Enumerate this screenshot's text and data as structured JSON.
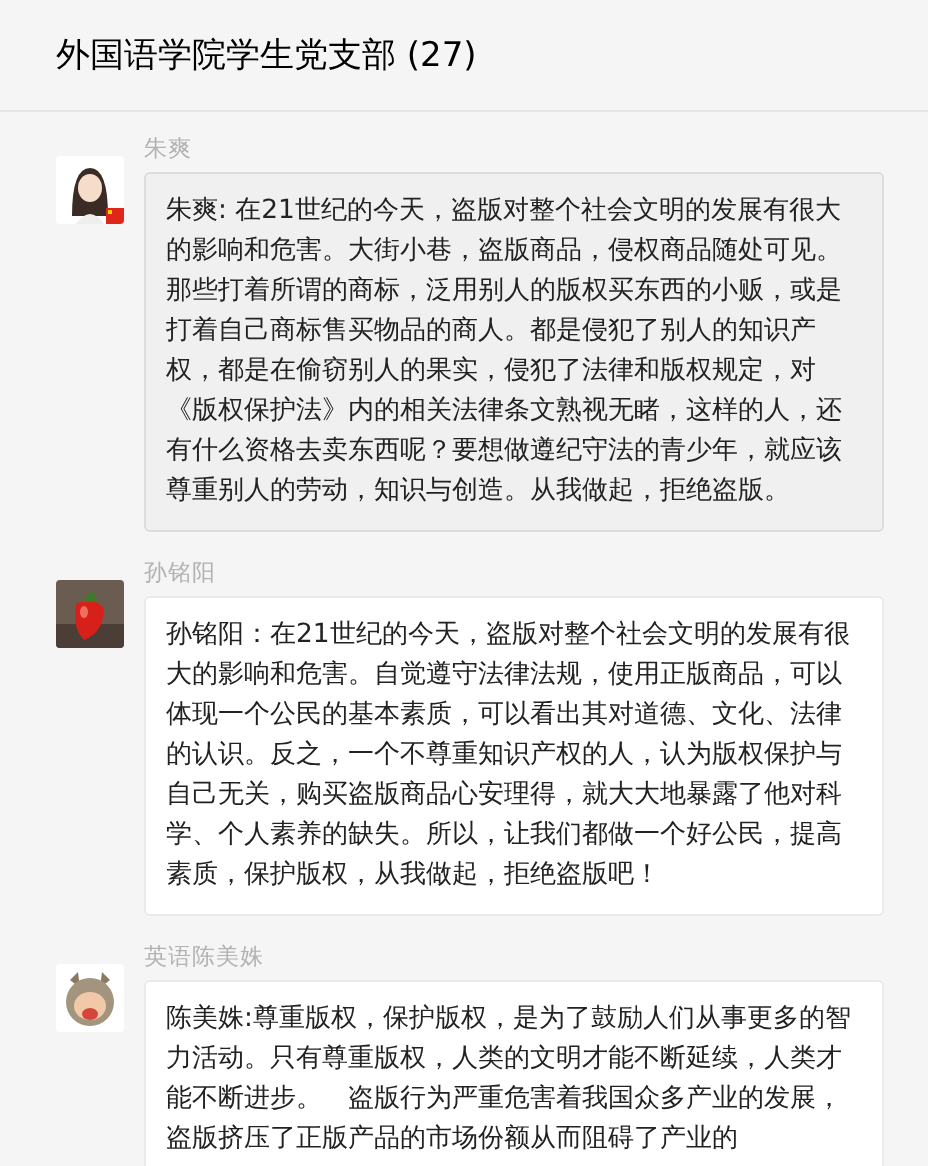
{
  "header": {
    "title": "外国语学院学生党支部 (27)"
  },
  "messages": [
    {
      "sender": "朱爽",
      "highlighted": true,
      "text": "朱爽: 在21世纪的今天，盗版对整个社会文明的发展有很大的影响和危害。大街小巷，盗版商品，侵权商品随处可见。那些打着所谓的商标，泛用别人的版权买东西的小贩，或是打着自己商标售买物品的商人。都是侵犯了别人的知识产权，都是在偷窃别人的果实，侵犯了法律和版权规定，对《版权保护法》内的相关法律条文熟视无睹，这样的人，还有什么资格去卖东西呢？要想做遵纪守法的青少年，就应该尊重别人的劳动，知识与创造。从我做起，拒绝盗版。"
    },
    {
      "sender": "孙铭阳",
      "highlighted": false,
      "text": "孙铭阳：在21世纪的今天，盗版对整个社会文明的发展有很大的影响和危害。自觉遵守法律法规，使用正版商品，可以体现一个公民的基本素质，可以看出其对道德、文化、法律的认识。反之，一个不尊重知识产权的人，认为版权保护与自己无关，购买盗版商品心安理得，就大大地暴露了他对科学、个人素养的缺失。所以，让我们都做一个好公民，提高素质，保护版权，从我做起，拒绝盗版吧！"
    },
    {
      "sender": "英语陈美姝",
      "highlighted": false,
      "text": "陈美姝:尊重版权，保护版权，是为了鼓励人们从事更多的智力活动。只有尊重版权，人类的文明才能不断延续，人类才能不断进步。　盗版行为严重危害着我国众多产业的发展，盗版挤压了正版产品的市场份额从而阻碍了产业的"
    }
  ]
}
